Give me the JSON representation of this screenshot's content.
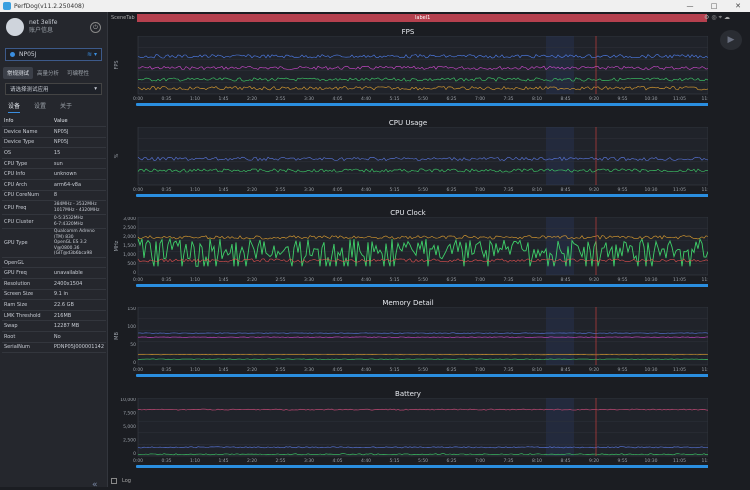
{
  "window": {
    "title": "PerfDog(v11.2.250408)"
  },
  "user": {
    "name": "net 3elife",
    "sub": "账户信息"
  },
  "device": {
    "name": "NP05J"
  },
  "modes": [
    "常规测试",
    "高量分析",
    "可编程性"
  ],
  "app_select": {
    "value": "请选择测试应用"
  },
  "subtabs": [
    "设备",
    "设置",
    "关于"
  ],
  "info_table": {
    "header": [
      "Info",
      "Value"
    ],
    "rows": [
      [
        "Device Name",
        "NP05J"
      ],
      [
        "Device Type",
        "NP05J"
      ],
      [
        "OS",
        "15"
      ],
      [
        "CPU Type",
        "sun"
      ],
      [
        "CPU Info",
        "unknown"
      ],
      [
        "CPU Arch",
        "arm64-v8a"
      ],
      [
        "CPU CoreNum",
        "8"
      ],
      [
        "CPU Freq",
        "384MHz - 3532MHz\n1017MHz - 4320MHz"
      ],
      [
        "CPU Cluster",
        "0-5:3532MHz\n6-7:4320MHz"
      ],
      [
        "GPU Type",
        "Qualcomm Adreno (TM) 830\nOpenGL ES 3.2 V@0800.36 (GIT@d3b6bca98"
      ],
      [
        "OpenGL",
        ""
      ],
      [
        "GPU Freq",
        "unavailable"
      ],
      [
        "Resolution",
        "2400x1504"
      ],
      [
        "Screen Size",
        "9.1 in"
      ],
      [
        "Ram Size",
        "22.6 GB"
      ],
      [
        "LMK Threshold",
        "216MB"
      ],
      [
        "Swap",
        "12287 MB"
      ],
      [
        "Root",
        "No"
      ],
      [
        "SerialNum",
        "PDNP05J000001142"
      ]
    ]
  },
  "scene": {
    "tab": "SceneTab",
    "label": "label1"
  },
  "footer": {
    "log": "Log"
  },
  "time_ticks": [
    "0:00",
    "0:35",
    "1:10",
    "1:45",
    "2:20",
    "2:55",
    "3:30",
    "4:05",
    "4:40",
    "5:15",
    "5:50",
    "6:25",
    "7:00",
    "7:35",
    "8:10",
    "8:45",
    "9:20",
    "9:55",
    "10:30",
    "11:05",
    "11:24"
  ],
  "panels": [
    {
      "title": "FPS",
      "ylabel": "FPS",
      "yticks": [],
      "colors": [
        "#d04ad0",
        "#3fd06a",
        "#5080f0",
        "#e0a030"
      ]
    },
    {
      "title": "CPU Usage",
      "ylabel": "%",
      "yticks": [],
      "colors": [
        "#5a78e0",
        "#3fd06a"
      ]
    },
    {
      "title": "CPU Clock",
      "ylabel": "MHz",
      "yticks": [
        "3,000",
        "2,500",
        "2,000",
        "1,500",
        "1,000",
        "500",
        "0"
      ],
      "colors": [
        "#3fd06a",
        "#e05050",
        "#e0a030"
      ]
    },
    {
      "title": "Memory Detail",
      "ylabel": "MB",
      "yticks": [
        "150",
        "100",
        "50",
        "0"
      ],
      "colors": [
        "#5a78e0",
        "#d04ad0",
        "#e0a030",
        "#3fd06a"
      ]
    },
    {
      "title": "Battery",
      "ylabel": "",
      "yticks": [
        "10,000",
        "7,500",
        "5,000",
        "2,500",
        "0"
      ],
      "colors": [
        "#d04a7a",
        "#5a78e0",
        "#3fd06a"
      ]
    }
  ]
}
